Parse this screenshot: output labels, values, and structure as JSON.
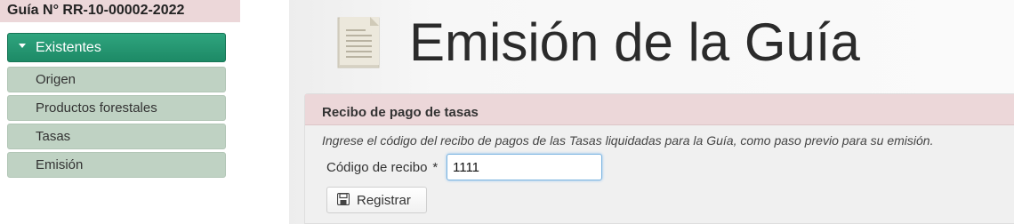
{
  "sidebar": {
    "guide_number": "Guía N° RR-10-00002-2022",
    "section_label": "Existentes",
    "items": [
      {
        "label": "Origen"
      },
      {
        "label": "Productos forestales"
      },
      {
        "label": "Tasas"
      },
      {
        "label": "Emisión"
      }
    ]
  },
  "main": {
    "title": "Emisión de la Guía",
    "title_icon": "document-icon",
    "panel": {
      "header": "Recibo de pago de tasas",
      "instructions": "Ingrese el código del recibo de pagos de las Tasas liquidadas para la Guía, como paso previo para su emisión.",
      "field_label": "Código de recibo",
      "required_mark": "*",
      "field_value": "1111",
      "submit_label": "Registrar",
      "submit_icon": "save-icon"
    }
  },
  "colors": {
    "accent_green": "#1d8a66",
    "menu_item_bg": "#bfd2c3",
    "header_pink": "#ecd7d9"
  }
}
